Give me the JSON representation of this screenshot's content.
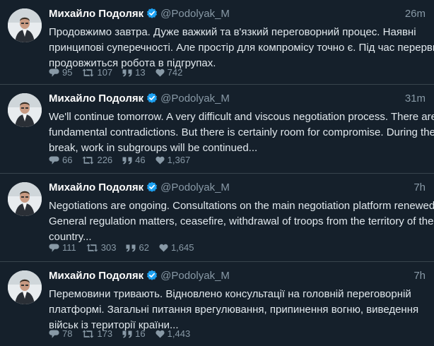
{
  "colors": {
    "background": "#15202b",
    "divider": "#38444d",
    "secondary_text": "#8899a6",
    "verified": "#1da1f2"
  },
  "tweets": [
    {
      "author_name": "Михайло Подоляк",
      "handle": "@Podolyak_M",
      "time": "26m",
      "lines": [
        "Продовжимо завтра. Дуже важкий та в'язкий переговорний процес. Наявні",
        "принципові суперечності. Але простір для компромісу точно є. Під час перерви",
        "продовжиться робота в підгрупах."
      ],
      "replies": "95",
      "retweets": "107",
      "quotes": "13",
      "likes": "742"
    },
    {
      "author_name": "Михайло Подоляк",
      "handle": "@Podolyak_M",
      "time": "31m",
      "lines": [
        "We'll continue tomorrow. A very difficult and viscous negotiation process. There are",
        "fundamental contradictions. But there is certainly room for compromise. During the",
        "break, work in subgroups will be continued..."
      ],
      "replies": "66",
      "retweets": "226",
      "quotes": "46",
      "likes": "1,367"
    },
    {
      "author_name": "Михайло Подоляк",
      "handle": "@Podolyak_M",
      "time": "7h",
      "lines": [
        "Negotiations are ongoing. Consultations on the main negotiation platform renewed.",
        "General regulation matters, ceasefire, withdrawal of troops from the territory of the",
        "country..."
      ],
      "replies": "111",
      "retweets": "303",
      "quotes": "62",
      "likes": "1,645"
    },
    {
      "author_name": "Михайло Подоляк",
      "handle": "@Podolyak_M",
      "time": "7h",
      "lines": [
        "Перемовини тривають. Відновлено консультації на головній переговорній",
        "платформі. Загальні питання врегулювання, припинення вогню, виведення",
        "військ із території країни..."
      ],
      "replies": "78",
      "retweets": "173",
      "quotes": "16",
      "likes": "1,443"
    }
  ]
}
